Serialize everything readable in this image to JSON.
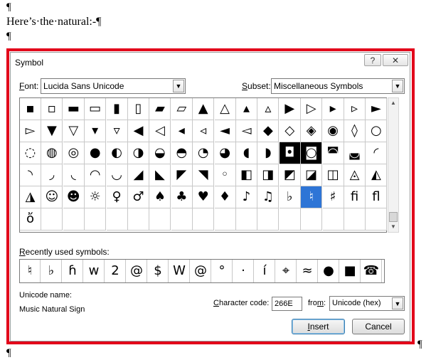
{
  "document": {
    "pilcrow": "¶",
    "line1": "Here’s·the·natural:-¶"
  },
  "dialog": {
    "title": "Symbol",
    "help_label": "?",
    "close_label": "✕",
    "font_label": "Font:",
    "font_value": "Lucida Sans Unicode",
    "subset_label": "Subset:",
    "subset_value": "Miscellaneous Symbols",
    "symbols": [
      [
        "▪",
        "▫",
        "▬",
        "▭",
        "▮",
        "▯",
        "▰",
        "▱",
        "▲",
        "△",
        "▴",
        "▵",
        "▶",
        "▷",
        "▸",
        "▹",
        "►"
      ],
      [
        "▻",
        "▼",
        "▽",
        "▾",
        "▿",
        "◀",
        "◁",
        "◂",
        "◃",
        "◄",
        "◅",
        "◆",
        "◇",
        "◈",
        "◉",
        "◊",
        "○"
      ],
      [
        "◌",
        "◍",
        "◎",
        "●",
        "◐",
        "◑",
        "◒",
        "◓",
        "◔",
        "◕",
        "◖",
        "◗",
        "◘",
        "◙",
        "◚",
        "◛",
        "◜"
      ],
      [
        "◝",
        "◞",
        "◟",
        "◠",
        "◡",
        "◢",
        "◣",
        "◤",
        "◥",
        "◦",
        "◧",
        "◨",
        "◩",
        "◪",
        "◫",
        "◬",
        "◭"
      ],
      [
        "◮",
        "☺",
        "☻",
        "☼",
        "♀",
        "♂",
        "♠",
        "♣",
        "♥",
        "♦",
        "♪",
        "♫",
        "♭",
        "♮",
        "♯",
        "ﬁ",
        "ﬂ"
      ],
      [
        "ὄ",
        "",
        "",
        "",
        "",
        "",
        "",
        "",
        "",
        "",
        "",
        "",
        "",
        "",
        "",
        "",
        ""
      ]
    ],
    "selected_symbol": "♮",
    "recent_label": "Recently used symbols:",
    "recent_symbols": [
      "♮",
      "♭",
      "ɦ",
      "w",
      "2",
      "@",
      "$",
      "W",
      "@",
      "°",
      "·",
      "í",
      "⌖",
      "≈",
      "●",
      "■",
      "☎"
    ],
    "unicode_name_label": "Unicode name:",
    "unicode_name_value": "Music Natural Sign",
    "char_code_label": "Character code:",
    "char_code_value": "266E",
    "from_label": "from:",
    "from_value": "Unicode (hex)",
    "insert_label": "Insert",
    "cancel_label": "Cancel"
  },
  "colors": {
    "highlight_border": "#e2001a",
    "selection": "#2e75d6"
  }
}
